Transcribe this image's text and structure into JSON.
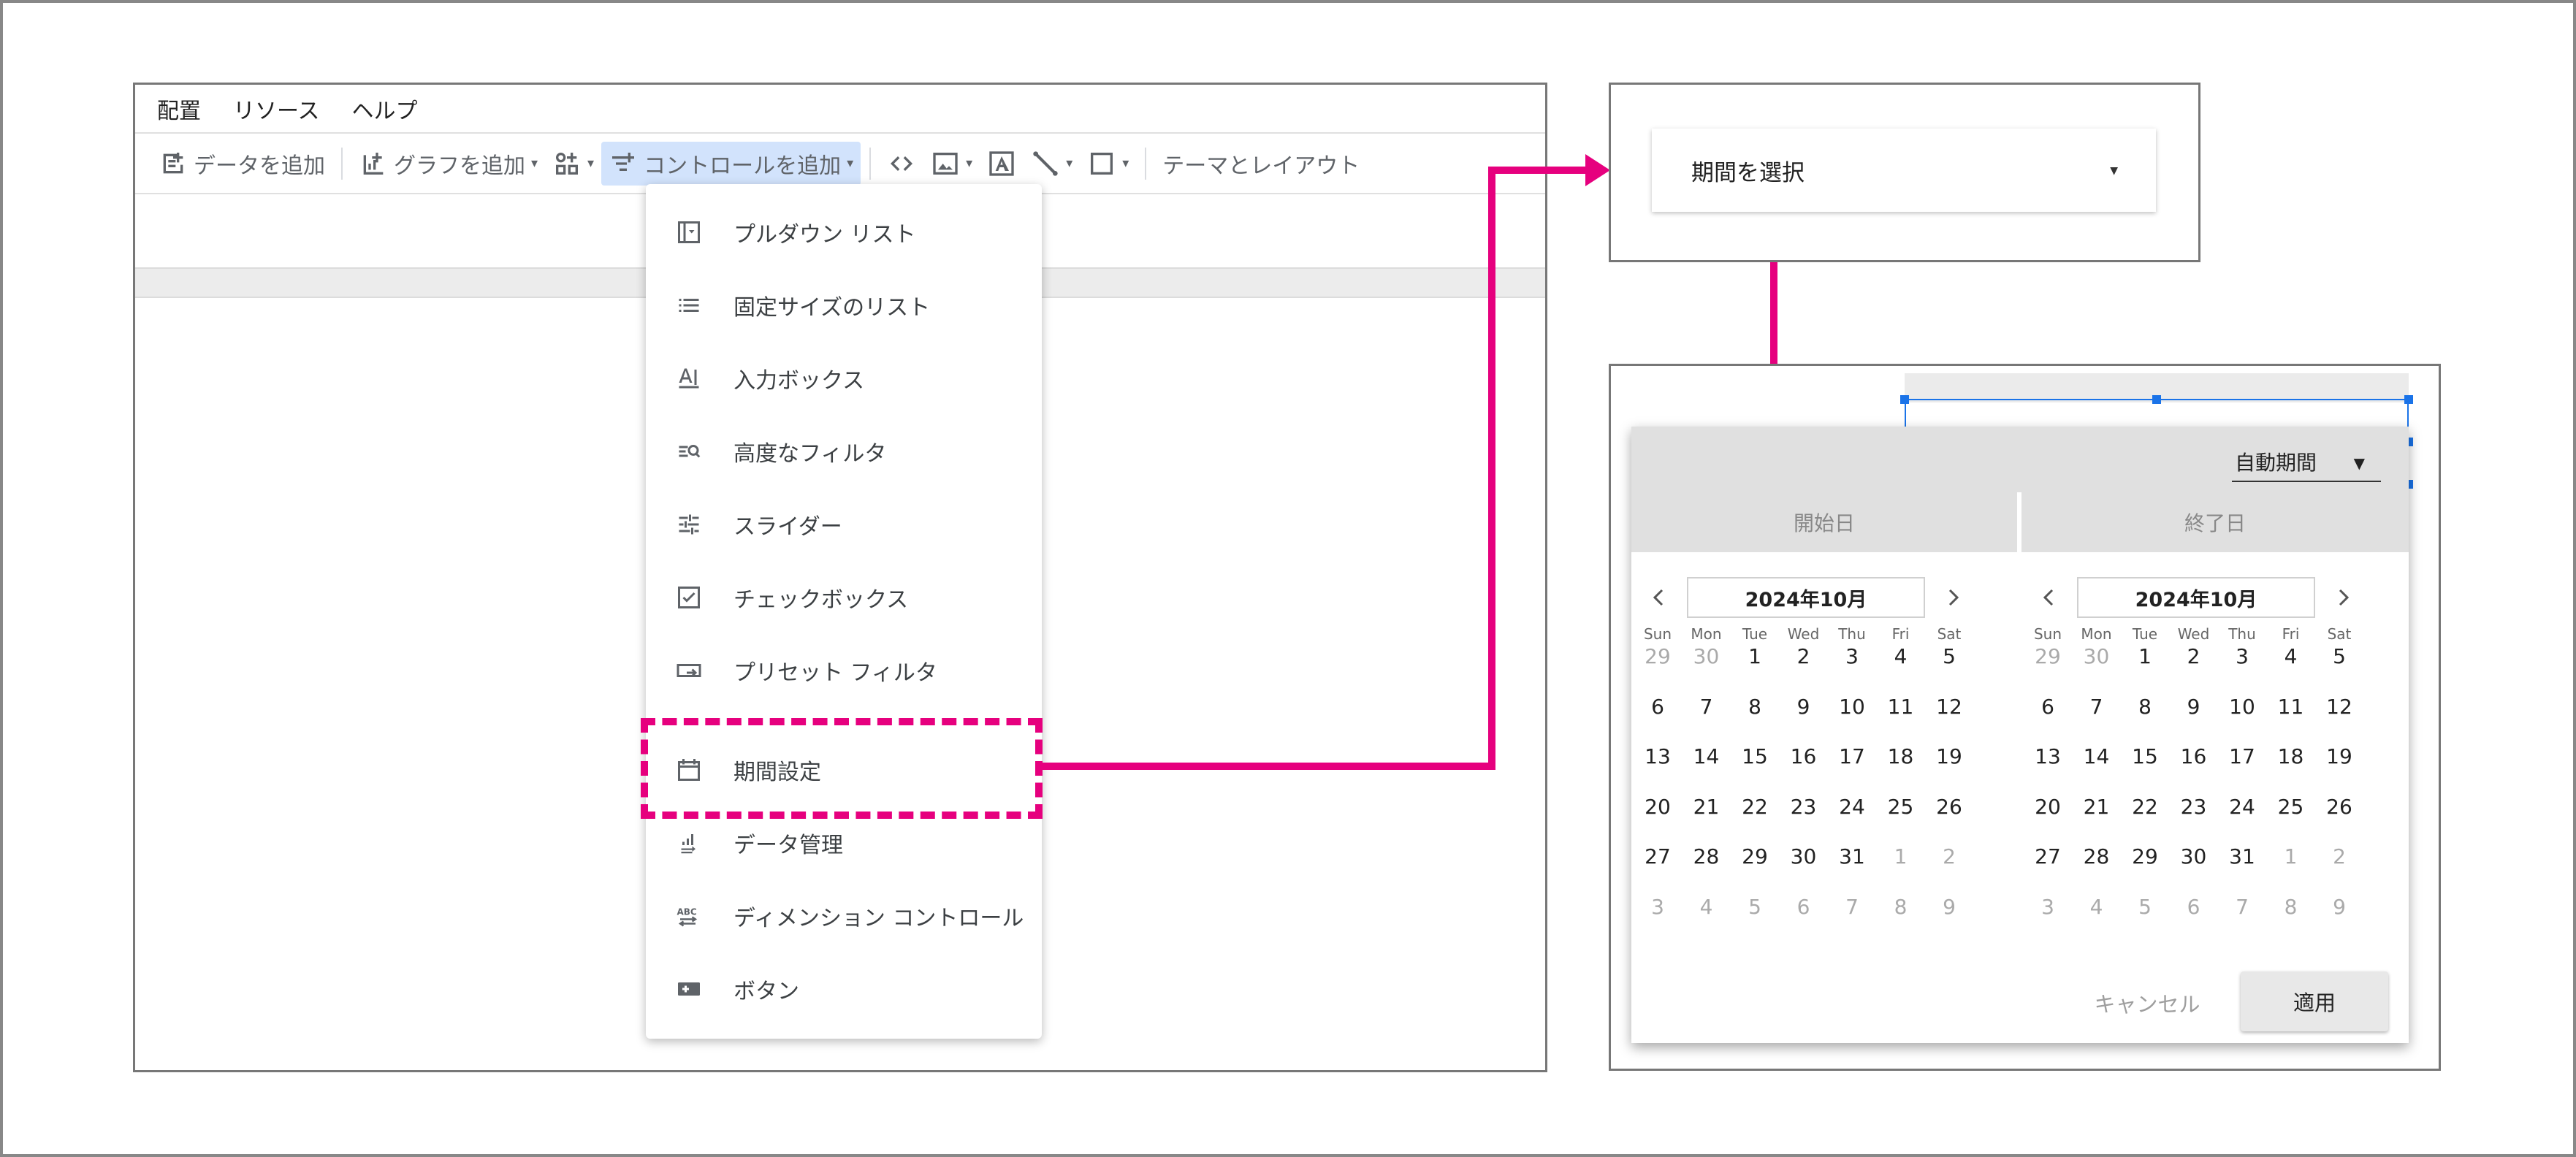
{
  "menubar": {
    "items": [
      "配置",
      "リソース",
      "ヘルプ"
    ]
  },
  "toolbar": {
    "add_data": "データを追加",
    "add_chart": "グラフを追加",
    "add_control": "コントロールを追加",
    "theme_layout": "テーマとレイアウト"
  },
  "dropdown": {
    "items": [
      {
        "label": "プルダウン リスト",
        "icon": "dropdown-list-icon"
      },
      {
        "label": "固定サイズのリスト",
        "icon": "fixed-list-icon"
      },
      {
        "label": "入力ボックス",
        "icon": "input-box-icon"
      },
      {
        "label": "高度なフィルタ",
        "icon": "advanced-filter-icon"
      },
      {
        "label": "スライダー",
        "icon": "slider-icon"
      },
      {
        "label": "チェックボックス",
        "icon": "checkbox-icon"
      },
      {
        "label": "プリセット フィルタ",
        "icon": "preset-filter-icon"
      },
      {
        "label": "期間設定",
        "icon": "calendar-icon"
      },
      {
        "label": "データ管理",
        "icon": "data-control-icon"
      },
      {
        "label": "ディメンション コントロール",
        "icon": "dimension-control-icon"
      },
      {
        "label": "ボタン",
        "icon": "button-icon"
      }
    ]
  },
  "period_card": {
    "label": "期間を選択"
  },
  "calendar": {
    "auto_period": "自動期間",
    "start_tab": "開始日",
    "end_tab": "終了日",
    "month_label": "2024年10月",
    "weekdays": [
      "Sun",
      "Mon",
      "Tue",
      "Wed",
      "Thu",
      "Fri",
      "Sat"
    ],
    "weeks": [
      [
        "29",
        "30",
        "1",
        "2",
        "3",
        "4",
        "5"
      ],
      [
        "6",
        "7",
        "8",
        "9",
        "10",
        "11",
        "12"
      ],
      [
        "13",
        "14",
        "15",
        "16",
        "17",
        "18",
        "19"
      ],
      [
        "20",
        "21",
        "22",
        "23",
        "24",
        "25",
        "26"
      ],
      [
        "27",
        "28",
        "29",
        "30",
        "31",
        "1",
        "2"
      ],
      [
        "3",
        "4",
        "5",
        "6",
        "7",
        "8",
        "9"
      ]
    ],
    "cancel": "キャンセル",
    "apply": "適用"
  },
  "colors": {
    "accent": "#e6007e",
    "selection": "#1a73e8",
    "active_toolbar": "#d2e3fc"
  }
}
